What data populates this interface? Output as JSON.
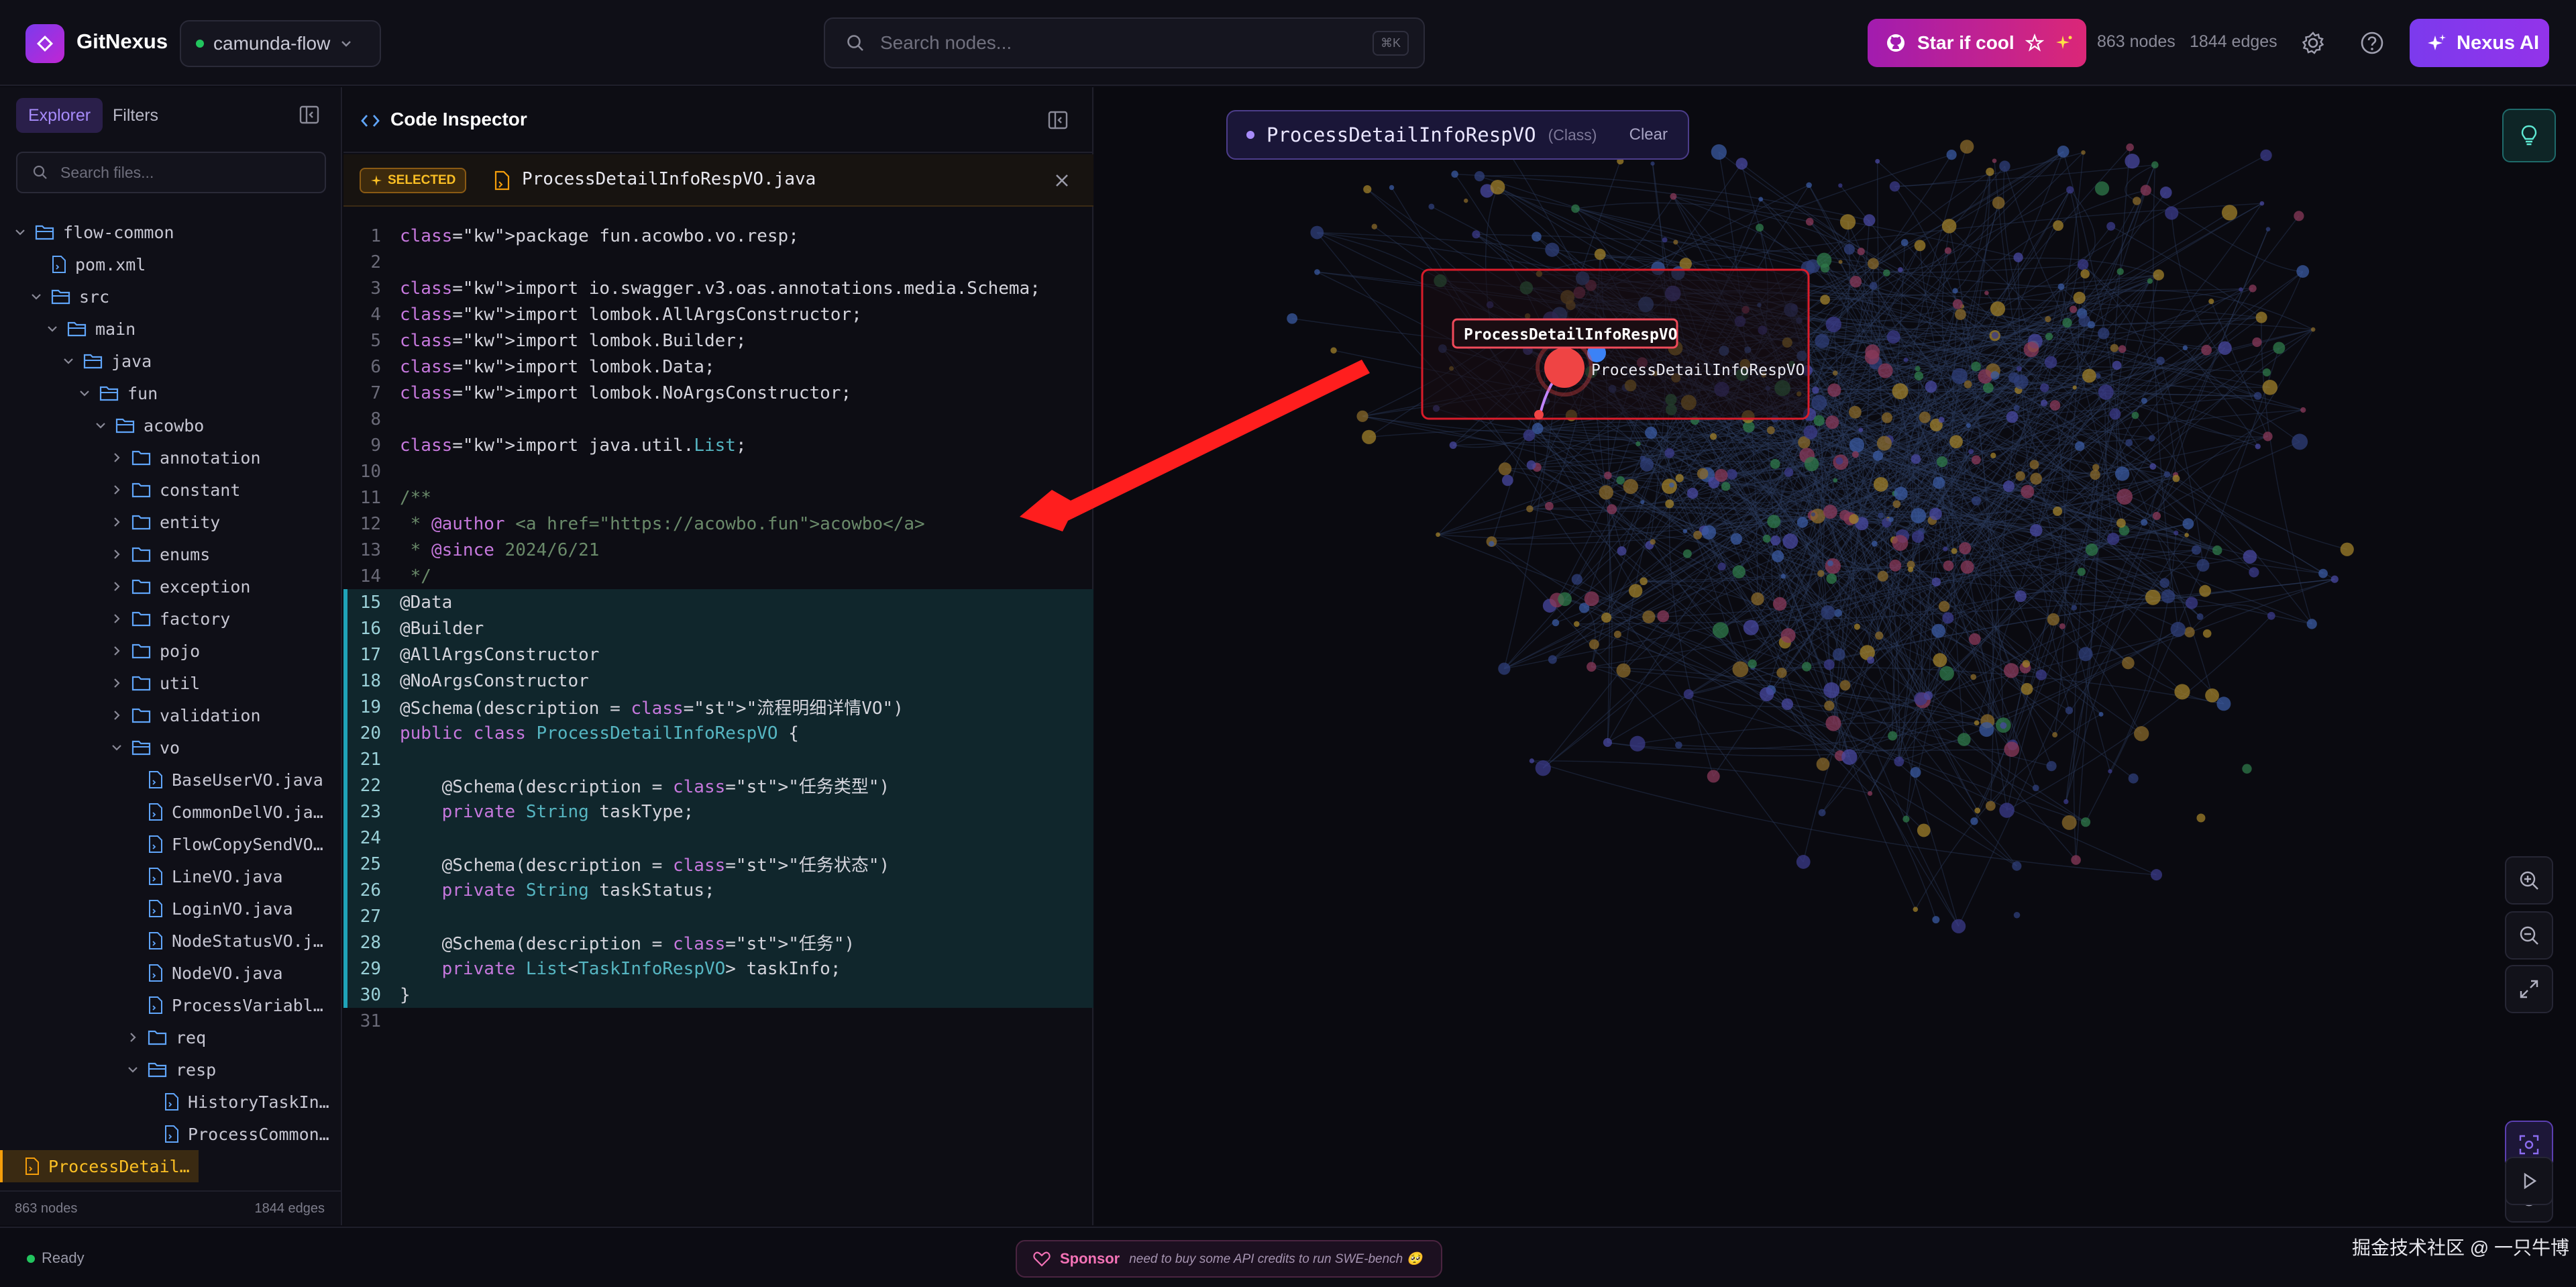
{
  "header": {
    "app_name": "GitNexus",
    "project": "camunda-flow",
    "search_placeholder": "Search nodes...",
    "search_shortcut": "⌘K",
    "star_label": "Star if cool",
    "nodes": "863 nodes",
    "edges": "1844 edges",
    "nexus_label": "Nexus AI"
  },
  "left": {
    "tabs": [
      "Explorer",
      "Filters"
    ],
    "search_placeholder": "Search files...",
    "tree": [
      {
        "label": "flow-common",
        "type": "folder-open",
        "depth": 0,
        "chevron": "down"
      },
      {
        "label": "pom.xml",
        "type": "file",
        "depth": 1
      },
      {
        "label": "src",
        "type": "folder-open",
        "depth": 1,
        "chevron": "down"
      },
      {
        "label": "main",
        "type": "folder-open",
        "depth": 2,
        "chevron": "down"
      },
      {
        "label": "java",
        "type": "folder-open",
        "depth": 3,
        "chevron": "down"
      },
      {
        "label": "fun",
        "type": "folder-open",
        "depth": 4,
        "chevron": "down"
      },
      {
        "label": "acowbo",
        "type": "folder-open",
        "depth": 5,
        "chevron": "down"
      },
      {
        "label": "annotation",
        "type": "folder",
        "depth": 6,
        "chevron": "right"
      },
      {
        "label": "constant",
        "type": "folder",
        "depth": 6,
        "chevron": "right"
      },
      {
        "label": "entity",
        "type": "folder",
        "depth": 6,
        "chevron": "right"
      },
      {
        "label": "enums",
        "type": "folder",
        "depth": 6,
        "chevron": "right"
      },
      {
        "label": "exception",
        "type": "folder",
        "depth": 6,
        "chevron": "right"
      },
      {
        "label": "factory",
        "type": "folder",
        "depth": 6,
        "chevron": "right"
      },
      {
        "label": "pojo",
        "type": "folder",
        "depth": 6,
        "chevron": "right"
      },
      {
        "label": "util",
        "type": "folder",
        "depth": 6,
        "chevron": "right"
      },
      {
        "label": "validation",
        "type": "folder",
        "depth": 6,
        "chevron": "right"
      },
      {
        "label": "vo",
        "type": "folder-open",
        "depth": 6,
        "chevron": "down"
      },
      {
        "label": "BaseUserVO.java",
        "type": "file",
        "depth": 7
      },
      {
        "label": "CommonDelVO.ja…",
        "type": "file",
        "depth": 7
      },
      {
        "label": "FlowCopySendVO…",
        "type": "file",
        "depth": 7
      },
      {
        "label": "LineVO.java",
        "type": "file",
        "depth": 7
      },
      {
        "label": "LoginVO.java",
        "type": "file",
        "depth": 7
      },
      {
        "label": "NodeStatusVO.j…",
        "type": "file",
        "depth": 7
      },
      {
        "label": "NodeVO.java",
        "type": "file",
        "depth": 7
      },
      {
        "label": "ProcessVariabl…",
        "type": "file",
        "depth": 7
      },
      {
        "label": "req",
        "type": "folder",
        "depth": 7,
        "chevron": "right"
      },
      {
        "label": "resp",
        "type": "folder-open",
        "depth": 7,
        "chevron": "down"
      },
      {
        "label": "HistoryTaskIn…",
        "type": "file",
        "depth": 8
      },
      {
        "label": "ProcessCommon…",
        "type": "file",
        "depth": 8
      },
      {
        "label": "ProcessDetail…",
        "type": "file",
        "depth": 8,
        "selected": true
      }
    ],
    "footer_nodes": "863 nodes",
    "footer_edges": "1844 edges"
  },
  "inspector": {
    "title": "Code Inspector",
    "badge": "SELECTED",
    "file_name": "ProcessDetailInfoRespVO.java",
    "lines": [
      "package fun.acowbo.vo.resp;",
      "",
      "import io.swagger.v3.oas.annotations.media.Schema;",
      "import lombok.AllArgsConstructor;",
      "import lombok.Builder;",
      "import lombok.Data;",
      "import lombok.NoArgsConstructor;",
      "",
      "import java.util.List;",
      "",
      "/**",
      " * @author <a href=\"https://acowbo.fun\">acowbo</a>",
      " * @since 2024/6/21",
      " */",
      "@Data",
      "@Builder",
      "@AllArgsConstructor",
      "@NoArgsConstructor",
      "@Schema(description = \"流程明细详情VO\")",
      "public class ProcessDetailInfoRespVO {",
      "",
      "    @Schema(description = \"任务类型\")",
      "    private String taskType;",
      "",
      "    @Schema(description = \"任务状态\")",
      "    private String taskStatus;",
      "",
      "    @Schema(description = \"任务\")",
      "    private List<TaskInfoRespVO> taskInfo;",
      "}",
      ""
    ],
    "highlight_from": 15,
    "highlight_to": 30
  },
  "graph": {
    "selected_name": "ProcessDetailInfoRespVO",
    "selected_kind": "(Class)",
    "clear_label": "Clear",
    "node_label_1": "ProcessDetailInfoRespVO",
    "node_label_2": "ProcessDetailInfoRespVO",
    "controls": [
      "zoom-in-icon",
      "zoom-out-icon",
      "fit-view-icon",
      "focus-target-icon",
      "reset-icon",
      "play-icon"
    ],
    "colors": {
      "selected": "#ef4444",
      "arrow": "#ff1e1e",
      "accent": "#a78bfa"
    }
  },
  "status": {
    "state": "Ready",
    "sponsor_label": "Sponsor",
    "sponsor_note": "need to buy some API credits to run SWE-bench 🥺",
    "watermark": "掘金技术社区 @ 一只牛博"
  }
}
